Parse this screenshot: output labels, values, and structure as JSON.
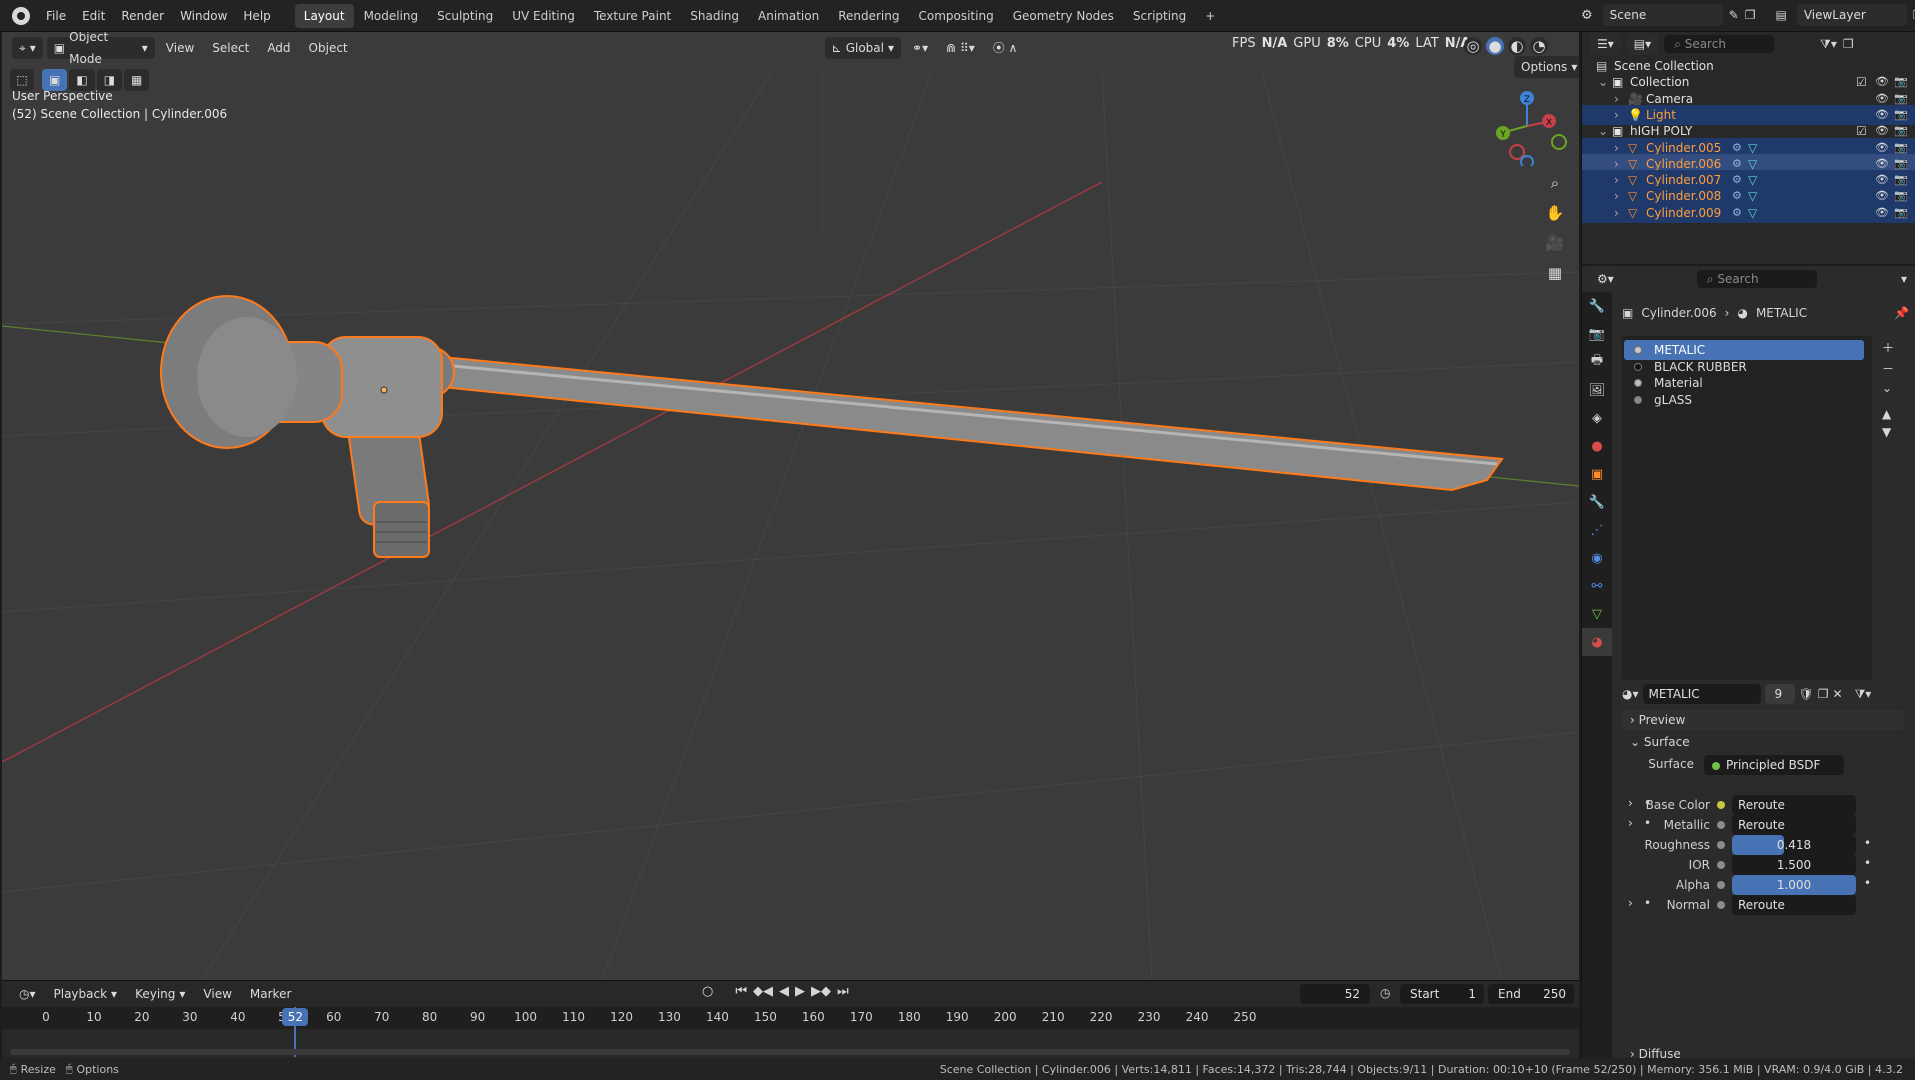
{
  "menu": [
    "File",
    "Edit",
    "Render",
    "Window",
    "Help"
  ],
  "workspaces": [
    "Layout",
    "Modeling",
    "Sculpting",
    "UV Editing",
    "Texture Paint",
    "Shading",
    "Animation",
    "Rendering",
    "Compositing",
    "Geometry Nodes",
    "Scripting"
  ],
  "active_workspace": "Layout",
  "add_workspace": "+",
  "scene": {
    "label": "Scene",
    "view_layer": "ViewLayer"
  },
  "viewport": {
    "mode": "Object Mode",
    "menus": [
      "View",
      "Select",
      "Add",
      "Object"
    ],
    "transform_orientation": "Global",
    "stats_overlay": {
      "fps": "FPS",
      "na1": "N/A",
      "gpu": "GPU",
      "gpu_val": "8%",
      "cpu": "CPU",
      "cpu_val": "4%",
      "lat": "LAT",
      "na2": "N/A"
    },
    "options": "Options",
    "perspective": "User Perspective",
    "context": "(52) Scene Collection | Cylinder.006",
    "gizmo": {
      "z": "Z",
      "y": "Y",
      "x": "X"
    }
  },
  "outliner": {
    "search_placeholder": "Search",
    "rows": [
      {
        "label": "Scene Collection",
        "type": "scene"
      },
      {
        "label": "Collection",
        "type": "collection"
      },
      {
        "label": "Camera",
        "type": "camera"
      },
      {
        "label": "Light",
        "type": "light"
      },
      {
        "label": "hIGH POLY",
        "type": "collection"
      },
      {
        "label": "Cylinder.005",
        "type": "mesh"
      },
      {
        "label": "Cylinder.006",
        "type": "mesh"
      },
      {
        "label": "Cylinder.007",
        "type": "mesh"
      },
      {
        "label": "Cylinder.008",
        "type": "mesh"
      },
      {
        "label": "Cylinder.009",
        "type": "mesh"
      }
    ]
  },
  "properties": {
    "search_placeholder": "Search",
    "breadcrumb_object": "Cylinder.006",
    "breadcrumb_material": "METALIC",
    "slots": [
      "METALIC",
      "BLACK RUBBER",
      "Material",
      "gLASS"
    ],
    "material_name": "METALIC",
    "users": "9",
    "panels": {
      "preview": "Preview",
      "surface": "Surface",
      "diffuse": "Diffuse"
    },
    "surface_label": "Surface",
    "surface_shader": "Principled BSDF",
    "inputs": [
      {
        "label": "Base Color",
        "value": "Reroute",
        "kind": "link"
      },
      {
        "label": "Metallic",
        "value": "Reroute",
        "kind": "link"
      },
      {
        "label": "Roughness",
        "value": "0.418",
        "kind": "slider",
        "fill": 0.418
      },
      {
        "label": "IOR",
        "value": "1.500",
        "kind": "value"
      },
      {
        "label": "Alpha",
        "value": "1.000",
        "kind": "slider",
        "fill": 1.0
      },
      {
        "label": "Normal",
        "value": "Reroute",
        "kind": "link"
      }
    ]
  },
  "timeline": {
    "menus": [
      "Playback",
      "Keying",
      "View",
      "Marker"
    ],
    "current_frame": "52",
    "start_label": "Start",
    "start": "1",
    "end_label": "End",
    "end": "250",
    "ticks": [
      "0",
      "10",
      "20",
      "30",
      "40",
      "50",
      "60",
      "70",
      "80",
      "90",
      "100",
      "110",
      "120",
      "130",
      "140",
      "150",
      "160",
      "170",
      "180",
      "190",
      "200",
      "210",
      "220",
      "230",
      "240",
      "250"
    ]
  },
  "statusbar": {
    "resize": "Resize",
    "options": "Options",
    "info": "Scene Collection | Cylinder.006 | Verts:14,811 | Faces:14,372 | Tris:28,744 | Objects:9/11 | Duration: 00:10+10 (Frame 52/250) | Memory: 356.1 MiB | VRAM: 0.9/4.0 GiB | 4.3.2"
  },
  "colors": {
    "accent": "#4772b3",
    "selection": "#ff7a1a",
    "x_axis": "#c7404a",
    "y_axis": "#6aa524",
    "z_axis": "#3b84d6"
  }
}
